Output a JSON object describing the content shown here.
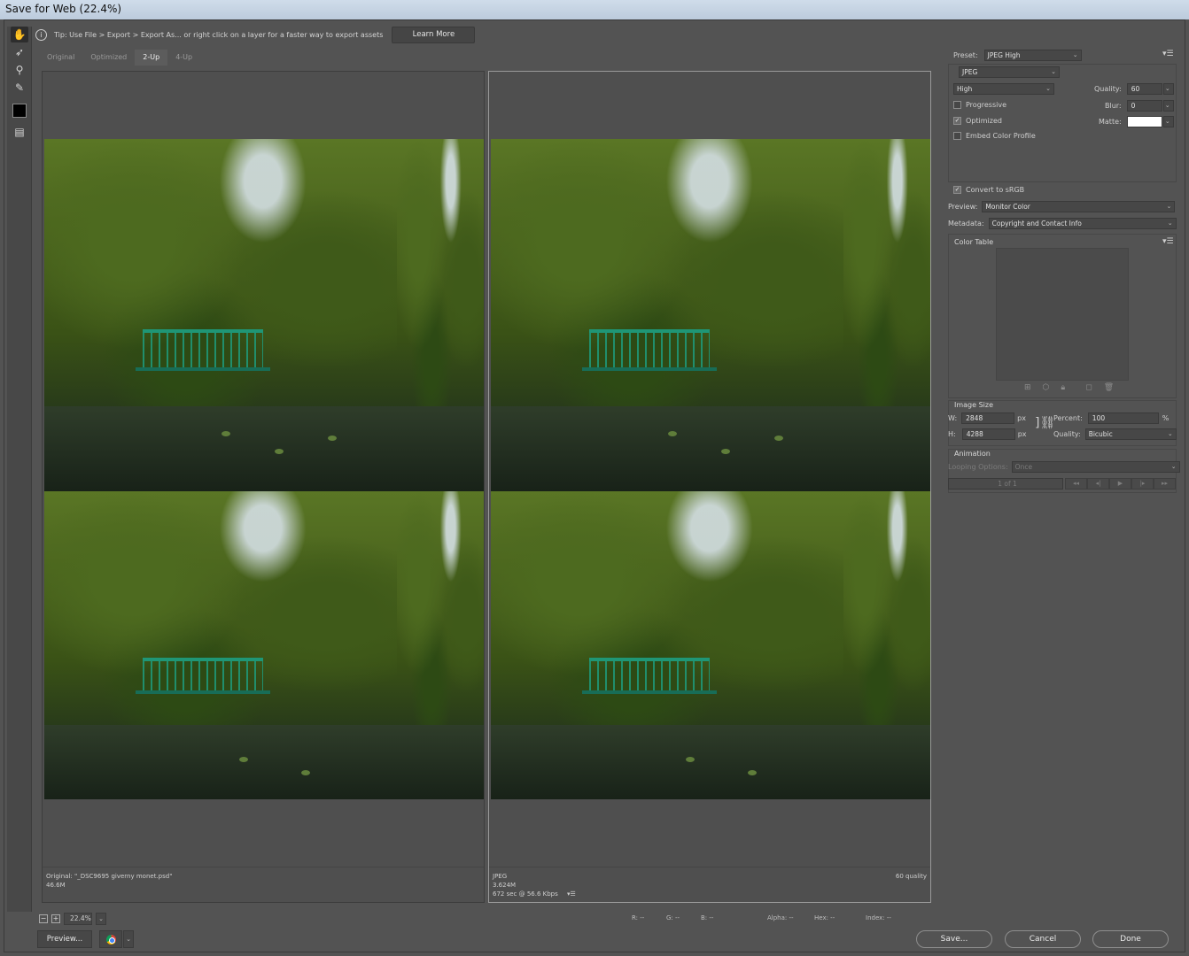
{
  "window": {
    "title": "Save for Web (22.4%)"
  },
  "toolbar": {
    "tools": [
      "hand-tool",
      "slice-select-tool",
      "zoom-tool",
      "eyedropper-tool"
    ],
    "eyedropper_color": "#000000"
  },
  "tip": {
    "text": "Tip: Use File > Export > Export As...  or right click on a layer for a faster way to export assets",
    "learn_more": "Learn More"
  },
  "tabs": [
    {
      "label": "Original",
      "active": false
    },
    {
      "label": "Optimized",
      "active": false
    },
    {
      "label": "2-Up",
      "active": true
    },
    {
      "label": "4-Up",
      "active": false
    }
  ],
  "panes": {
    "left": {
      "line1": "Original: \"_DSC9695 giverny monet.psd\"",
      "line2": "46.6M"
    },
    "right": {
      "line1": "JPEG",
      "line2": "3.624M",
      "line3": "672 sec @ 56.6 Kbps",
      "quality_note": "60 quality"
    }
  },
  "status": {
    "zoom": "22.4%",
    "r": "R: --",
    "g": "G: --",
    "b": "B: --",
    "alpha": "Alpha: --",
    "hex": "Hex: --",
    "index": "Index: --"
  },
  "buttons": {
    "preview": "Preview...",
    "save": "Save...",
    "cancel": "Cancel",
    "done": "Done"
  },
  "settings": {
    "preset_label": "Preset:",
    "preset_value": "JPEG High",
    "format": "JPEG",
    "compression": "High",
    "quality_label": "Quality:",
    "quality_value": "60",
    "blur_label": "Blur:",
    "blur_value": "0",
    "matte_label": "Matte:",
    "progressive": {
      "label": "Progressive",
      "checked": false
    },
    "optimized": {
      "label": "Optimized",
      "checked": true
    },
    "embed_profile": {
      "label": "Embed Color Profile",
      "checked": false
    },
    "convert_srgb": {
      "label": "Convert to sRGB",
      "checked": true
    },
    "preview_label": "Preview:",
    "preview_value": "Monitor Color",
    "metadata_label": "Metadata:",
    "metadata_value": "Copyright and Contact Info",
    "color_table_title": "Color Table"
  },
  "image_size": {
    "title": "Image Size",
    "w_label": "W:",
    "w_value": "2848",
    "h_label": "H:",
    "h_value": "4288",
    "unit": "px",
    "percent_label": "Percent:",
    "percent_value": "100",
    "percent_unit": "%",
    "quality_label": "Quality:",
    "quality_value": "Bicubic"
  },
  "animation": {
    "title": "Animation",
    "looping_label": "Looping Options:",
    "looping_value": "Once",
    "frame_counter": "1 of 1"
  }
}
